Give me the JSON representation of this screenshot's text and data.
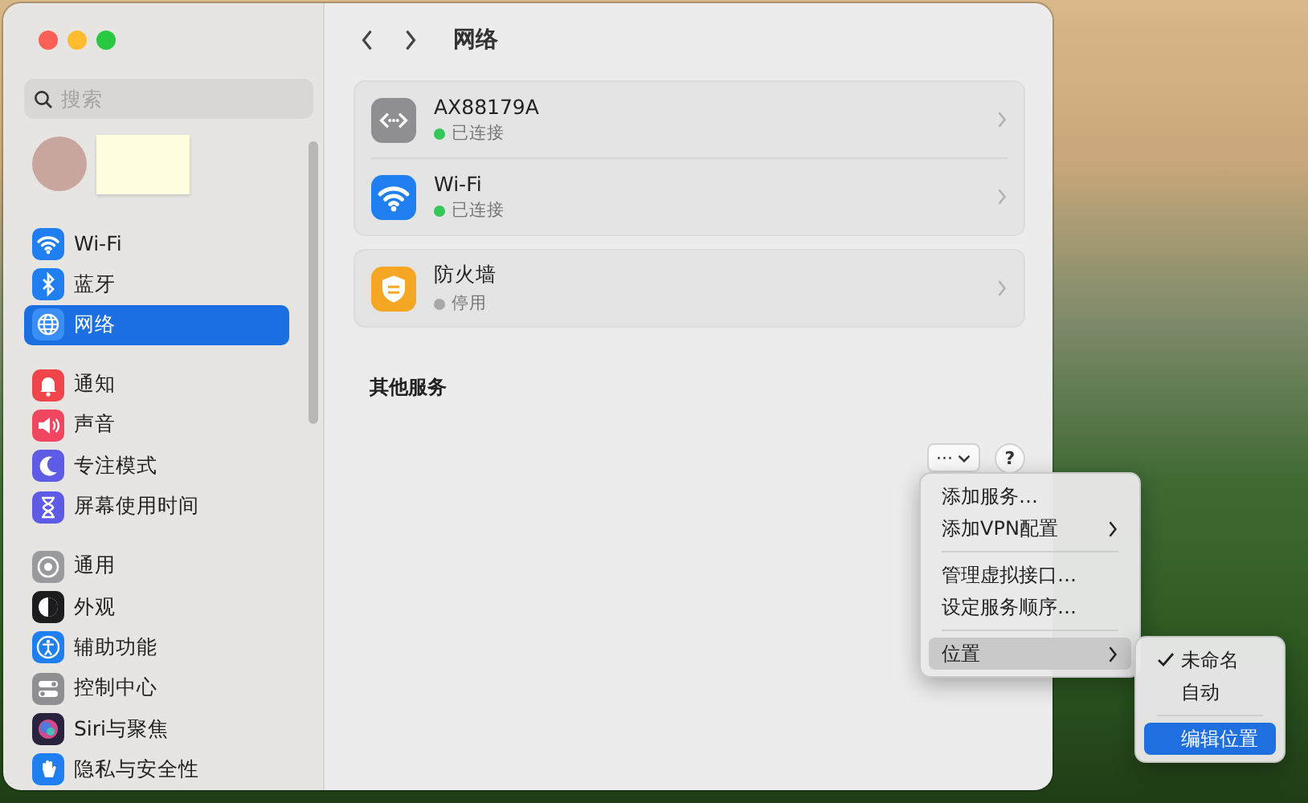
{
  "sidebar": {
    "search": {
      "placeholder": "搜索"
    },
    "groups": [
      [
        {
          "label": "Wi-Fi",
          "kind": "wifi",
          "selected": false
        },
        {
          "label": "蓝牙",
          "kind": "bluetooth",
          "selected": false
        },
        {
          "label": "网络",
          "kind": "globe",
          "selected": true
        }
      ],
      [
        {
          "label": "通知",
          "kind": "bell",
          "selected": false
        },
        {
          "label": "声音",
          "kind": "speaker",
          "selected": false
        },
        {
          "label": "专注模式",
          "kind": "moon",
          "selected": false
        },
        {
          "label": "屏幕使用时间",
          "kind": "hourglass",
          "selected": false
        }
      ],
      [
        {
          "label": "通用",
          "kind": "gear",
          "selected": false
        },
        {
          "label": "外观",
          "kind": "appearance",
          "selected": false
        },
        {
          "label": "辅助功能",
          "kind": "accessibility",
          "selected": false
        },
        {
          "label": "控制中心",
          "kind": "toggles",
          "selected": false
        },
        {
          "label": "Siri与聚焦",
          "kind": "siri",
          "selected": false
        },
        {
          "label": "隐私与安全性",
          "kind": "hand",
          "selected": false
        }
      ]
    ]
  },
  "main": {
    "title": "网络",
    "cards": [
      [
        {
          "name": "AX88179A",
          "status": "已连接",
          "kind": "ethernet",
          "color": "#34c759"
        },
        {
          "name": "Wi-Fi",
          "status": "已连接",
          "kind": "wifi",
          "color": "#34c759"
        }
      ],
      [
        {
          "name": "防火墙",
          "status": "停用",
          "kind": "firewall",
          "color": "#a8a8a8"
        }
      ]
    ],
    "section_heading": "其他服务",
    "more_button": {
      "label": "···"
    },
    "help_button": {
      "label": "?"
    }
  },
  "menu": {
    "groups": [
      [
        {
          "label": "添加服务…",
          "submenu": false,
          "selected": false
        },
        {
          "label": "添加VPN配置",
          "submenu": true,
          "selected": false
        }
      ],
      [
        {
          "label": "管理虚拟接口…",
          "submenu": false,
          "selected": false
        },
        {
          "label": "设定服务顺序…",
          "submenu": false,
          "selected": false
        }
      ],
      [
        {
          "label": "位置",
          "submenu": true,
          "selected": true
        }
      ]
    ]
  },
  "submenu": {
    "groups": [
      [
        {
          "label": "未命名",
          "checked": true,
          "selected": false
        },
        {
          "label": "自动",
          "checked": false,
          "selected": false
        }
      ],
      [
        {
          "label": "编辑位置",
          "checked": false,
          "selected": true
        }
      ]
    ]
  }
}
